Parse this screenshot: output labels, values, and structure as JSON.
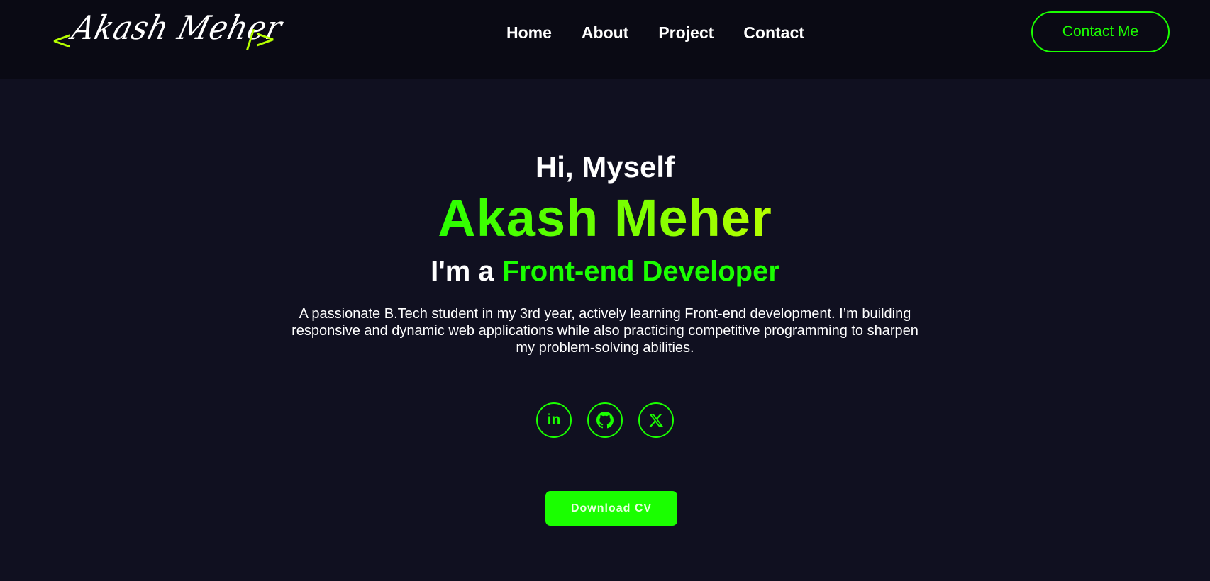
{
  "colors": {
    "page_bg": "#101020",
    "nav_bg": "#0a0a14",
    "accent_green": "#1aff00",
    "accent_lime": "#b6ff00",
    "text_white": "#ffffff",
    "button_text": "#e9ffe0"
  },
  "logo": {
    "bracket_open": "<",
    "signature": "Akash Meher",
    "bracket_close": "/>"
  },
  "nav": {
    "links": [
      {
        "label": "Home"
      },
      {
        "label": "About"
      },
      {
        "label": "Project"
      },
      {
        "label": "Contact"
      }
    ],
    "cta_label": "Contact Me"
  },
  "hero": {
    "greeting": "Hi, Myself",
    "name": "Akash Meher",
    "role_prefix": "I'm a",
    "role_highlight": "Front-end Developer",
    "description": "A passionate B.Tech student in my 3rd year, actively learning Front-end development. I’m building responsive and dynamic web applications while also practicing competitive programming to sharpen my problem-solving abilities.",
    "socials": [
      {
        "icon": "linkedin-icon",
        "glyph": "in"
      },
      {
        "icon": "github-icon"
      },
      {
        "icon": "x-twitter-icon"
      }
    ],
    "download_label": "Download CV"
  }
}
